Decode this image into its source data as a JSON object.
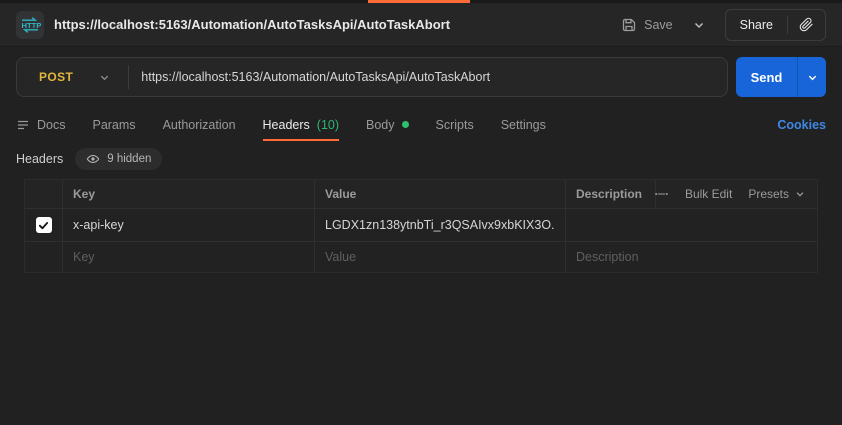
{
  "topbar": {
    "title": "https://localhost:5163/Automation/AutoTasksApi/AutoTaskAbort",
    "save_label": "Save",
    "share_label": "Share"
  },
  "request": {
    "method": "POST",
    "url": "https://localhost:5163/Automation/AutoTasksApi/AutoTaskAbort",
    "send_label": "Send"
  },
  "tabs": {
    "items": [
      {
        "label": "Docs"
      },
      {
        "label": "Params"
      },
      {
        "label": "Authorization"
      },
      {
        "label": "Headers",
        "count": "(10)",
        "active": true
      },
      {
        "label": "Body",
        "modified": true
      },
      {
        "label": "Scripts"
      },
      {
        "label": "Settings"
      }
    ],
    "cookies_label": "Cookies"
  },
  "headers_section": {
    "title": "Headers",
    "hidden_badge": "9 hidden",
    "table": {
      "columns": {
        "key": "Key",
        "value": "Value",
        "description": "Description"
      },
      "bulk_edit_label": "Bulk Edit",
      "presets_label": "Presets",
      "rows": [
        {
          "enabled": true,
          "key": "x-api-key",
          "value": "LGDX1zn138ytnbTi_r3QSAIvx9xbKIX3O...",
          "description": ""
        }
      ],
      "placeholders": {
        "key": "Key",
        "value": "Value",
        "description": "Description"
      }
    }
  },
  "icons": {
    "http_badge": "http-arrows-icon",
    "save": "floppy-disk-icon",
    "share_link": "paperclip-icon",
    "docs": "align-left-icon",
    "hidden": "eye-icon",
    "bulk_edit": "connected-dots-icon",
    "chevron": "chevron-down-icon"
  },
  "colors": {
    "accent_orange": "#ff6c37",
    "send_button_blue": "#1765d8",
    "method_post_yellow": "#e2b63c",
    "link_blue": "#3f87e5",
    "count_green": "#2bb673",
    "background": "#212121",
    "topbar_background": "#262626"
  }
}
